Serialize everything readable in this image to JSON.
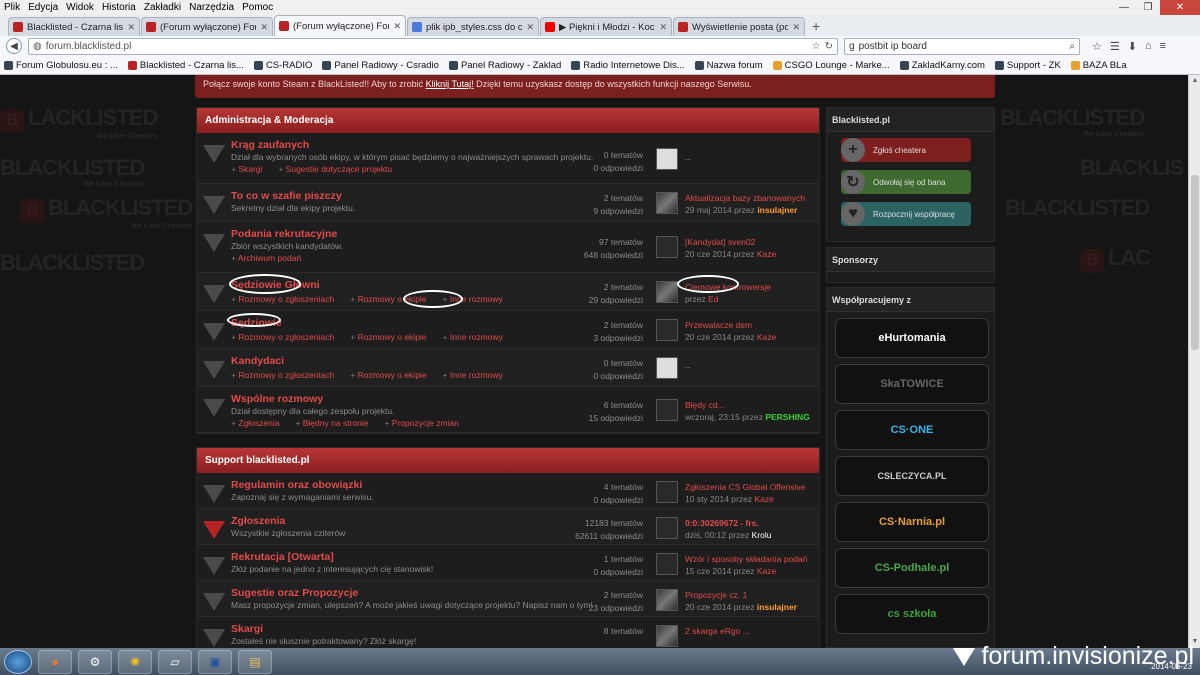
{
  "menu": [
    "Plik",
    "Edycja",
    "Widok",
    "Historia",
    "Zakładki",
    "Narzędzia",
    "Pomoc"
  ],
  "tabs": [
    {
      "label": "Blacklisted - Czarna lista ch...",
      "icon": "blacklisted-favicon"
    },
    {
      "label": "(Forum wyłączone) Forum ...",
      "icon": "blacklisted-favicon"
    },
    {
      "label": "(Forum wyłączone) Forum ...",
      "icon": "blacklisted-favicon",
      "active": true
    },
    {
      "label": "plik ipb_styles.css do carbo...",
      "icon": "google-favicon"
    },
    {
      "label": "▶ Piękni i Młodzi - Kocha...",
      "icon": "youtube-favicon"
    },
    {
      "label": "Wyświetlenie posta (postbi...",
      "icon": "checkmark-favicon"
    }
  ],
  "address": {
    "url": "forum.blacklisted.pl",
    "search": "postbit ip board"
  },
  "bookmarks": [
    "Forum Globulosu.eu : ...",
    "Blacklisted - Czarna lis...",
    "CS-RADIO",
    "Panel Radiowy - Csradio",
    "Panel Radiowy - Zaklad",
    "Radio Internetowe Dis...",
    "Nazwa forum",
    "CSGO Lounge - Marke...",
    "ZakladKarny.com",
    "Support - ZK",
    "BAZA BLa"
  ],
  "notice": {
    "text": "Połącz swoje konto Steam z BlackListed!! Aby to zrobić ",
    "link": "Kliknij Tutaj!",
    "rest": " Dzięki temu uzyskasz dostęp do wszystkich funkcji naszego Serwisu."
  },
  "categories": [
    {
      "title": "Administracja & Moderacja",
      "forums": [
        {
          "title": "Krąg zaufanych",
          "desc": "Dział dla wybranych osób ekipy, w którym pisać będziemy o najważniejszych sprawach projektu.",
          "subs": [
            "Skargi",
            "Sugestie dotyczące projektu"
          ],
          "topics": "0 tematów",
          "posts": "0 odpowiedzi",
          "last": "--"
        },
        {
          "title": "To co w szafie piszczy",
          "desc": "Sekretny dział dla ekipy projektu.",
          "subs": [],
          "topics": "2 tematów",
          "posts": "9 odpowiedzi",
          "last": "Aktualizacja bazy zbanowanych",
          "date": "29 maj 2014 przez",
          "user": "insulajner"
        },
        {
          "title": "Podania rekrutacyjne",
          "desc": "Zbiór wszystkich kandydatów.",
          "subs": [
            "Archiwum podań"
          ],
          "topics": "97 tematów",
          "posts": "648 odpowiedzi",
          "last": "[Kandydat] sven02",
          "date": "20 cze 2014 przez",
          "user": "Kaze"
        },
        {
          "title": "Sędziowie Główni",
          "desc": "",
          "subs": [
            "Rozmowy o zgłoszeniach",
            "Rozmowy o ekipie",
            "Inne rozmowy"
          ],
          "topics": "2 tematów",
          "posts": "29 odpowiedzi",
          "last": "Ciemowe kontrowersje",
          "date": "przez",
          "user": "Ed"
        },
        {
          "title": "Sędziowie",
          "desc": "",
          "subs": [
            "Rozmowy o zgłoszeniach",
            "Rozmowy o ekipie",
            "Inne rozmowy"
          ],
          "topics": "2 tematów",
          "posts": "3 odpowiedzi",
          "last": "Przewalacze dem",
          "date": "20 cze 2014 przez",
          "user": "Kaze"
        },
        {
          "title": "Kandydaci",
          "desc": "",
          "subs": [
            "Rozmowy o zgłoszeniach",
            "Rozmowy o ekipie",
            "Inne rozmowy"
          ],
          "topics": "0 tematów",
          "posts": "0 odpowiedzi",
          "last": "--"
        },
        {
          "title": "Wspólne rozmowy",
          "desc": "Dział dostępny dla całego zespołu projektu.",
          "subs": [
            "Zgłoszenia",
            "Błędny na stronie",
            "Propozycje zmian"
          ],
          "topics": "6 tematów",
          "posts": "15 odpowiedzi",
          "last": "Błędy cd...",
          "date": "wczoraj, 23:15 przez",
          "user": "PERSHING"
        }
      ]
    },
    {
      "title": "Support blacklisted.pl",
      "forums": [
        {
          "title": "Regulamin oraz obowiązki",
          "desc": "Zapoznaj się z wymaganiami serwisu.",
          "topics": "4 tematów",
          "posts": "0 odpowiedzi",
          "last": "Zgłoszenia CS Global Offensive",
          "date": "10 sty 2014 przez",
          "user": "Kaze"
        },
        {
          "title": "Zgłoszenia",
          "desc": "Wszystkie zgłoszenia cziterów",
          "topics": "12183 tematów",
          "posts": "62611 odpowiedzi",
          "last": "0:0:30269672 - frs.",
          "date": "dziś, 00:12 przez",
          "user": "Krolu"
        },
        {
          "title": "Rekrutacja [Otwarta]",
          "desc": "Złóż podanie na jedno z interesujących cię stanowisk!",
          "topics": "1 tematów",
          "posts": "0 odpowiedzi",
          "last": "Wzór i sposoby składania podań",
          "date": "15 cze 2014 przez",
          "user": "Kaze"
        },
        {
          "title": "Sugestie oraz Propozycje",
          "desc": "Masz propozycje zmian, ulepszeń? A może jakieś uwagi dotyczące projektu? Napisz nam o tym!",
          "topics": "2 tematów",
          "posts": "23 odpowiedzi",
          "last": "Propozycje cz. 1",
          "date": "20 cze 2014 przez",
          "user": "insulajner"
        },
        {
          "title": "Skargi",
          "desc": "Zostałeś nie słusznie potraktowany? Złóż skargę!",
          "topics": "8 tematów",
          "posts": "",
          "last": "2 skarga eRgo ...",
          "date": "",
          "user": ""
        }
      ]
    }
  ],
  "sidebar": {
    "site": "Blacklisted.pl",
    "actions": [
      "Zgłoś cheatera",
      "Odwołaj się od bana",
      "Rozpocznij współpracę"
    ],
    "sponsors": "Sponsorzy",
    "partners_title": "Współpracujemy z",
    "partners": [
      "eHurtomania",
      "SkaTOWICE",
      "CS·ONE",
      "CSLECZYCA.PL",
      "CS·Narnia.pl",
      "CS-Podhale.pl",
      "cs szkoła"
    ]
  },
  "taskbar": {
    "date": "2014-06-23"
  },
  "watermark": "forum.invisionize.pl"
}
